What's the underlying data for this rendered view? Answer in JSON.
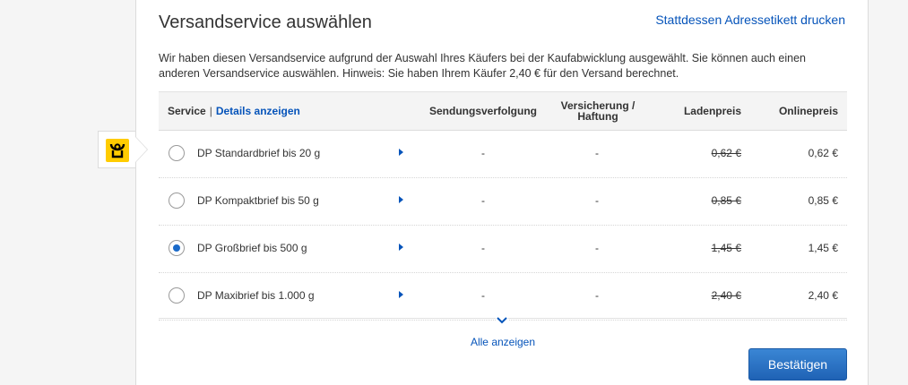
{
  "header": {
    "title": "Versandservice auswählen",
    "print_label_link": "Stattdessen Adressetikett drucken"
  },
  "intro": {
    "text": "Wir haben diesen Versandservice aufgrund der Auswahl Ihres Käufers bei der Kaufabwicklung ausgewählt. Sie können auch einen anderen Versandservice auswählen. Hinweis: Sie haben Ihrem Käufer 2,40 € für den Versand berechnet."
  },
  "table": {
    "headers": {
      "service": "Service",
      "separator": "|",
      "details_link": "Details anzeigen",
      "tracking": "Sendungsverfolgung",
      "insurance": "Versicherung / Haftung",
      "store_price": "Ladenpreis",
      "online_price": "Onlinepreis"
    },
    "rows": [
      {
        "name": "DP Standardbrief bis 20 g",
        "tracking": "-",
        "insurance": "-",
        "store_price": "0,62 €",
        "online_price": "0,62 €",
        "selected": false
      },
      {
        "name": "DP Kompaktbrief bis 50 g",
        "tracking": "-",
        "insurance": "-",
        "store_price": "0,85 €",
        "online_price": "0,85 €",
        "selected": false
      },
      {
        "name": "DP Großbrief bis 500 g",
        "tracking": "-",
        "insurance": "-",
        "store_price": "1,45 €",
        "online_price": "1,45 €",
        "selected": true
      },
      {
        "name": "DP Maxibrief bis 1.000 g",
        "tracking": "-",
        "insurance": "-",
        "store_price": "2,40 €",
        "online_price": "2,40 €",
        "selected": false
      }
    ]
  },
  "show_all_label": "Alle anzeigen",
  "confirm_button_label": "Bestätigen",
  "colors": {
    "link": "#0654ba",
    "button": "#1f6bc0",
    "carrier_logo": "#ffcc00"
  },
  "icons": {
    "carrier_logo": "deutsche-post-horn-icon",
    "row_arrow": "triangle-right-icon",
    "show_all": "chevron-down-icon"
  }
}
